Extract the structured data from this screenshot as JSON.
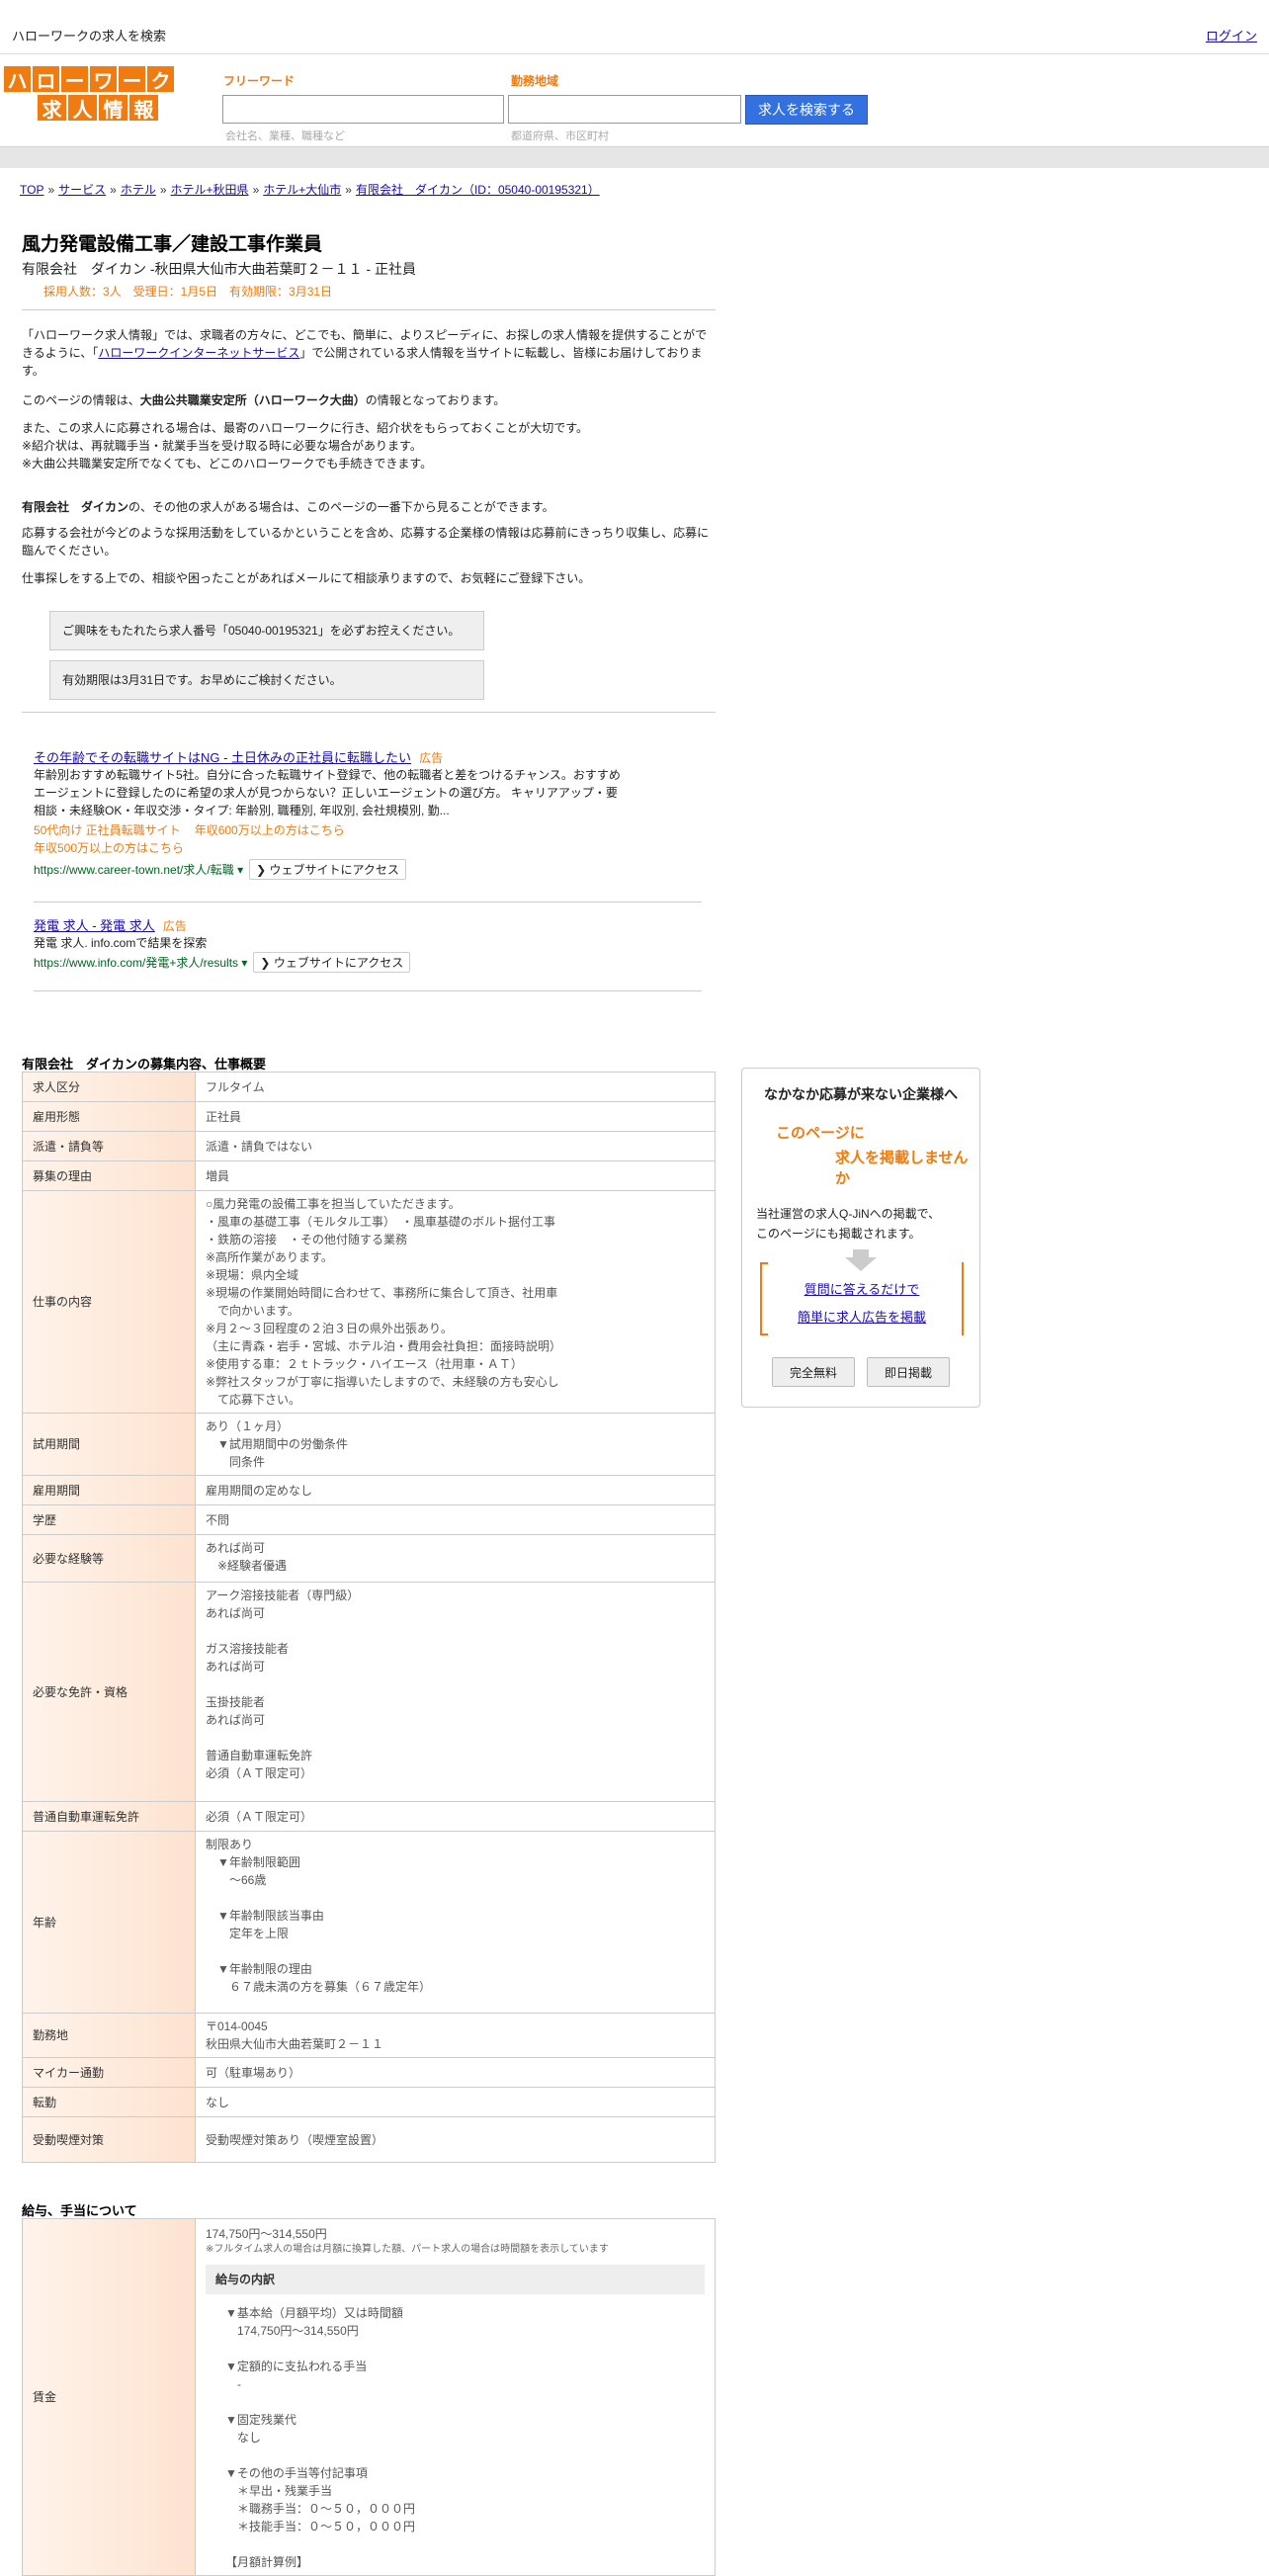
{
  "topbar": {
    "title": "ハローワークの求人を検索",
    "login": "ログイン"
  },
  "logo": {
    "row1": [
      "ハ",
      "ロ",
      "ー",
      "ワ",
      "ー",
      "ク"
    ],
    "row2": [
      "求",
      "人",
      "情",
      "報"
    ]
  },
  "search": {
    "freeword_label": "フリーワード",
    "freeword_placeholder": "会社名、業種、職種など",
    "area_label": "勤務地域",
    "area_placeholder": "都道府県、市区町村",
    "button": "求人を検索する"
  },
  "breadcrumb": [
    "TOP",
    "サービス",
    "ホテル",
    "ホテル+秋田県",
    "ホテル+大仙市",
    "有限会社　ダイカン（ID：05040-00195321）"
  ],
  "job": {
    "title": "風力発電設備工事／建設工事作業員",
    "company_line": "有限会社　ダイカン -秋田県大仙市大曲若葉町２－１１ - 正社員",
    "meta": "採用人数：3人　受理日：1月5日　有効期限：3月31日"
  },
  "intro": {
    "p1_pre": "「ハローワーク求人情報」では、求職者の方々に、どこでも、簡単に、よりスピーディに、お探しの求人情報を提供することができるように、「",
    "p1_link": "ハローワークインターネットサービス",
    "p1_post": "」で公開されている求人情報を当サイトに転載し、皆様にお届けしております。",
    "p2_pre": "このページの情報は、",
    "p2_bold": "大曲公共職業安定所（ハローワーク大曲）",
    "p2_post": "の情報となっております。",
    "p3": "また、この求人に応募される場合は、最寄のハローワークに行き、紹介状をもらっておくことが大切です。\n※紹介状は、再就職手当・就業手当を受け取る時に必要な場合があります。\n※大曲公共職業安定所でなくても、どこのハローワークでも手続きできます。",
    "p4_bold": "有限会社　ダイカン",
    "p4_post": "の、その他の求人がある場合は、このページの一番下から見ることができます。",
    "p5": "応募する会社が今どのような採用活動をしているかということを含め、応募する企業様の情報は応募前にきっちり収集し、応募に臨んでください。",
    "p6": "仕事探しをする上での、相談や困ったことがあればメールにて相談承りますので、お気軽にご登録下さい。"
  },
  "notices": {
    "n1": "ご興味をもたれたら求人番号「05040-00195321」を必ずお控えください。",
    "n2": "有効期限は3月31日です。お早めにご検討ください。"
  },
  "ads": [
    {
      "title": "その年齢でその転職サイトはNG - 土日休みの正社員に転職したい",
      "badge": "広告",
      "desc": "年齢別おすすめ転職サイト5社。自分に合った転職サイト登録で、他の転職者と差をつけるチャンス。おすすめエージェントに登録したのに希望の求人が見つからない？正しいエージェントの選び方。 キャリアアップ・要相談・未経験OK・年収交渉・タイプ: 年齢別, 職種別, 年収別, 会社規模別, 勤...",
      "sub1a": "50代向け 正社員転職サイト",
      "sub1b": "年収600万以上の方はこちら",
      "sub2": "年収500万以上の方はこちら",
      "url": "https://www.career-town.net/求人/転職",
      "visit": "ウェブサイトにアクセス"
    },
    {
      "title": "発電 求人 - 発電 求人",
      "badge": "広告",
      "desc": "発電 求人. info.comで結果を探索",
      "url": "https://www.info.com/発電+求人/results",
      "visit": "ウェブサイトにアクセス"
    }
  ],
  "details": {
    "title": "有限会社　ダイカンの募集内容、仕事概要",
    "rows": [
      {
        "k": "求人区分",
        "v": "フルタイム"
      },
      {
        "k": "雇用形態",
        "v": "正社員"
      },
      {
        "k": "派遣・請負等",
        "v": "派遣・請負ではない"
      },
      {
        "k": "募集の理由",
        "v": "増員"
      },
      {
        "k": "仕事の内容",
        "v": "○風力発電の設備工事を担当していただきます。\n・風車の基礎工事（モルタル工事）　・風車基礎のボルト据付工事\n・鉄筋の溶接　・その他付随する業務\n※高所作業があります。\n※現場：県内全域\n※現場の作業開始時間に合わせて、事務所に集合して頂き、社用車\n　で向かいます。\n※月２～３回程度の２泊３日の県外出張あり。\n（主に青森・岩手・宮城、ホテル泊・費用会社負担：面接時説明）\n※使用する車：２ｔトラック・ハイエース（社用車・ＡＴ）\n※弊社スタッフが丁寧に指導いたしますので、未経験の方も安心し\n　て応募下さい。"
      },
      {
        "k": "試用期間",
        "v": "あり（１ヶ月）\n　▼試用期間中の労働条件\n　　同条件"
      },
      {
        "k": "雇用期間",
        "v": "雇用期間の定めなし"
      },
      {
        "k": "学歴",
        "v": "不問"
      },
      {
        "k": "必要な経験等",
        "v": "あれば尚可\n　※経験者優遇"
      },
      {
        "k": "必要な免許・資格",
        "v": "アーク溶接技能者（専門級）\nあれば尚可\n\nガス溶接技能者\nあれば尚可\n\n玉掛技能者\nあれば尚可\n\n普通自動車運転免許\n必須（ＡＴ限定可）"
      },
      {
        "k": "普通自動車運転免許",
        "v": "必須（ＡＴ限定可）"
      },
      {
        "k": "年齢",
        "v": "制限あり\n　▼年齢制限範囲\n　　〜66歳\n\n　▼年齢制限該当事由\n　　定年を上限\n\n　▼年齢制限の理由\n　　６７歳未満の方を募集（６７歳定年）"
      },
      {
        "k": "勤務地",
        "v": "〒014-0045\n秋田県大仙市大曲若葉町２－１１"
      },
      {
        "k": "マイカー通勤",
        "v": "可（駐車場あり）"
      },
      {
        "k": "転勤",
        "v": "なし"
      },
      {
        "k": "受動喫煙対策",
        "v": "受動喫煙対策あり（喫煙室設置）"
      }
    ]
  },
  "wage": {
    "title": "給与、手当について",
    "key": "賃金",
    "amount": "174,750円〜314,550円",
    "note": "※フルタイム求人の場合は月額に換算した額、パート求人の場合は時間額を表示しています",
    "breakdown_title": "給与の内訳",
    "breakdown": "▼基本給（月額平均）又は時間額\n　174,750円〜314,550円\n\n▼定額的に支払われる手当\n　-\n\n▼固定残業代\n　なし\n\n▼その他の手当等付記事項\n　＊早出・残業手当\n　＊職務手当：０～５０，０００円\n　＊技能手当：０～５０，０００円\n\n【月額計算例】"
  },
  "side": {
    "heading": "なかなか応募が来ない企業様へ",
    "orange1": "このページに",
    "orange2": "求人を掲載しませんか",
    "text": "当社運営の求人Q-JiNへの掲載で、\nこのページにも掲載されます。",
    "link1": "質問に答えるだけで",
    "link2": "簡単に求人広告を掲載",
    "btn1": "完全無料",
    "btn2": "即日掲載"
  }
}
